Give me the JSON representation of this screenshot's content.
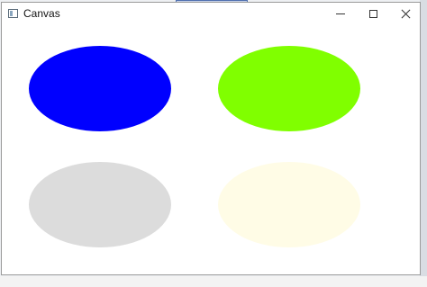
{
  "window": {
    "title": "Canvas",
    "icon": "window-app-icon"
  },
  "controls": {
    "minimize_icon": "minimize-icon",
    "maximize_icon": "maximize-icon",
    "close_icon": "close-icon"
  },
  "canvas": {
    "ellipses": [
      {
        "name": "blue-ellipse",
        "color": "#0000ff"
      },
      {
        "name": "lime-ellipse",
        "color": "#80ff00"
      },
      {
        "name": "gray-ellipse",
        "color": "#dcdcdc"
      },
      {
        "name": "ivory-ellipse",
        "color": "#fffce6"
      }
    ]
  }
}
